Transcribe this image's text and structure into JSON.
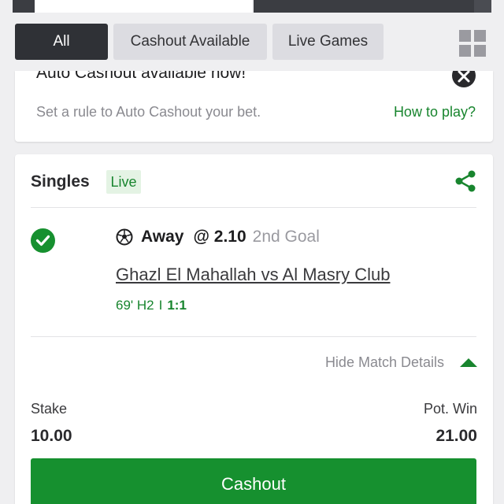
{
  "filters": {
    "all": "All",
    "cashout_available": "Cashout Available",
    "live_games": "Live Games"
  },
  "promo": {
    "title": "Auto Cashout available now!",
    "text": "Set a rule to Auto Cashout your bet.",
    "link": "How to play?"
  },
  "bet": {
    "type": "Singles",
    "live_badge": "Live",
    "selection": {
      "pick": "Away",
      "odds": "@ 2.10",
      "market": "2nd Goal",
      "match": "Ghazl El Mahallah vs Al Masry Club",
      "time": "69' H2",
      "separator": "I",
      "score": "1:1"
    },
    "details_toggle": "Hide Match Details",
    "stake_label": "Stake",
    "stake_value": "10.00",
    "potwin_label": "Pot. Win",
    "potwin_value": "21.00",
    "cashout_label": "Cashout"
  },
  "colors": {
    "accent_green": "#16902f",
    "dark_chip": "#2f3136",
    "background": "#efeff1"
  },
  "icons": {
    "grid": "grid-icon",
    "close": "close-icon",
    "share": "share-icon",
    "check": "check-circle-icon",
    "ball": "soccer-ball-icon",
    "caret": "caret-up-icon"
  }
}
